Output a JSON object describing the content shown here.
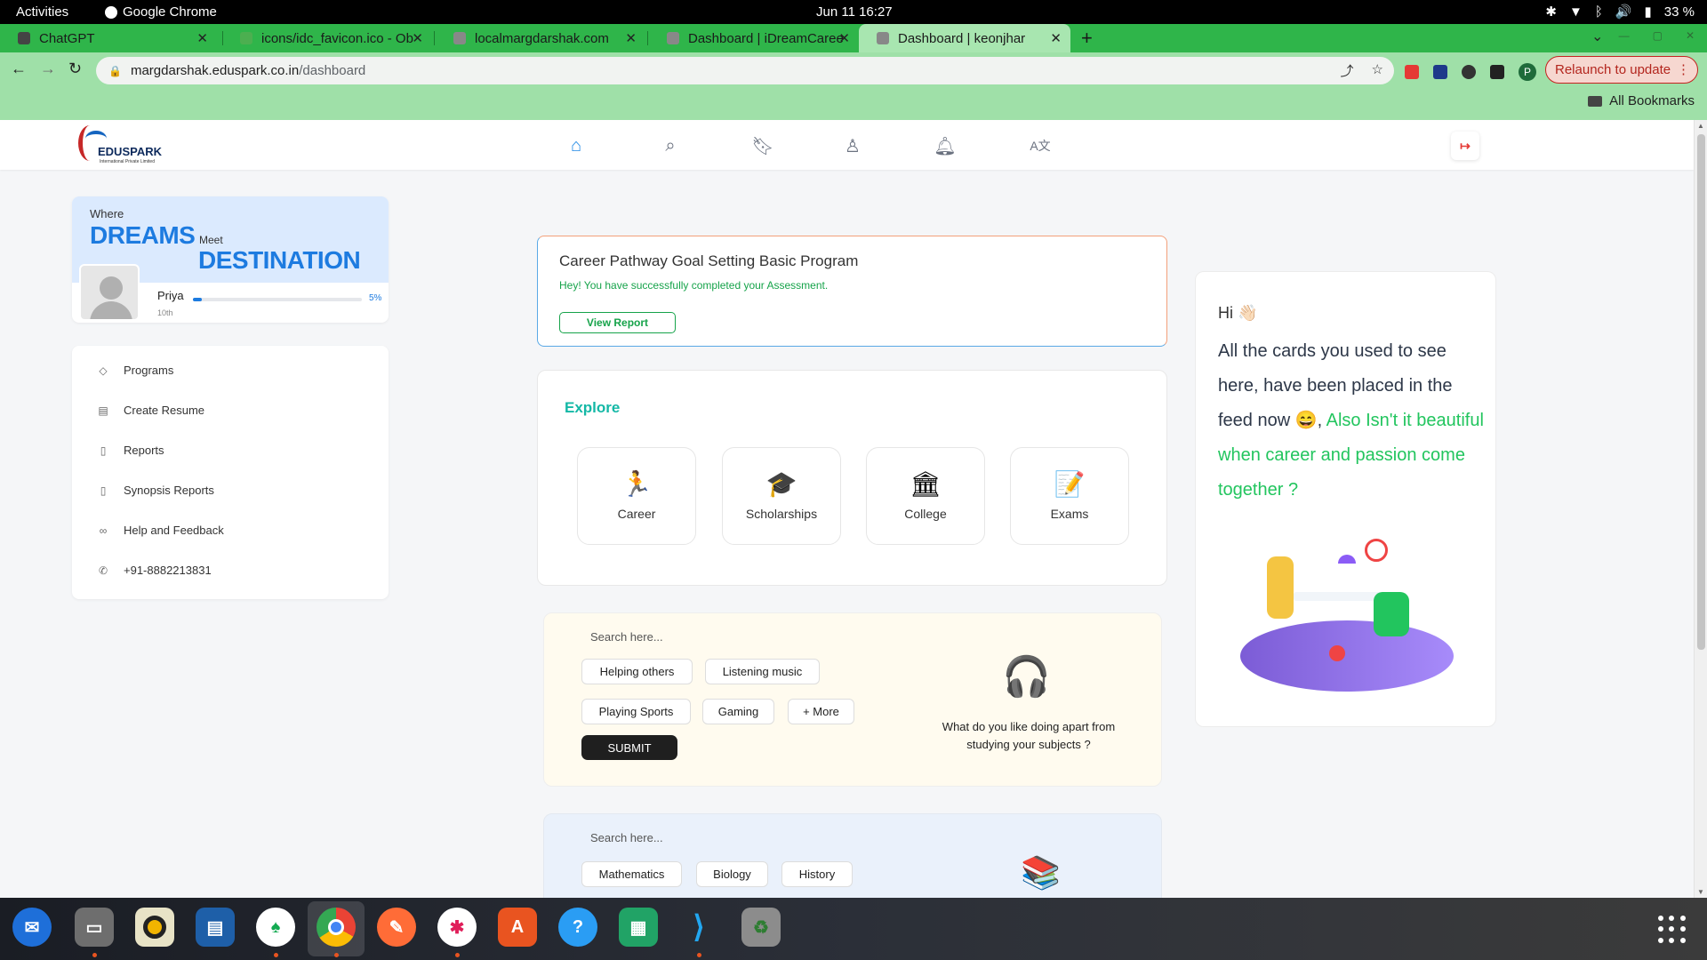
{
  "system": {
    "activities": "Activities",
    "app_name": "Google Chrome",
    "clock": "Jun 11  16:27",
    "battery": "33 %"
  },
  "tabs": [
    {
      "title": "ChatGPT",
      "favicon_color": "#444444"
    },
    {
      "title": "icons/idc_favicon.ico - Ob",
      "favicon_color": "#4caf50"
    },
    {
      "title": "localmargdarshak.com",
      "favicon_color": "#888888"
    },
    {
      "title": "Dashboard | iDreamCaree",
      "favicon_color": "#888888"
    },
    {
      "title": "Dashboard | keonjhar",
      "favicon_color": "#888888",
      "active": true
    }
  ],
  "toolbar": {
    "url_host": "margdarshak.eduspark.co.in",
    "url_path": "/dashboard",
    "profile_initial": "P",
    "relaunch_label": "Relaunch to update",
    "bookmarks_label": "All Bookmarks"
  },
  "logo": {
    "name": "EDUSPARK",
    "sub": "International Private Limited"
  },
  "nav_icons": [
    "home-icon",
    "search-icon",
    "bookmark-icon",
    "user-icon",
    "bell-icon",
    "translate-icon"
  ],
  "profile": {
    "banner_where": "Where",
    "banner_dreams": "DREAMS",
    "banner_meet": "Meet",
    "banner_destination": "DESTINATION",
    "name": "Priya",
    "grade": "10th",
    "progress_percent": 5,
    "progress_label": "5%"
  },
  "sidebar": {
    "items": [
      {
        "label": "Programs",
        "icon": "tag-icon"
      },
      {
        "label": "Create Resume",
        "icon": "clipboard-icon"
      },
      {
        "label": "Reports",
        "icon": "document-icon"
      },
      {
        "label": "Synopsis Reports",
        "icon": "document-icon"
      },
      {
        "label": "Help and Feedback",
        "icon": "handshake-icon"
      },
      {
        "label": "+91-8882213831",
        "icon": "phone-icon"
      }
    ]
  },
  "assessment": {
    "title": "Career Pathway Goal Setting Basic Program",
    "status": "Hey! You have successfully completed your Assessment.",
    "button": "View Report"
  },
  "explore": {
    "heading": "Explore",
    "cards": [
      {
        "label": "Career",
        "icon": "runner-icon"
      },
      {
        "label": "Scholarships",
        "icon": "graduation-cap-icon"
      },
      {
        "label": "College",
        "icon": "building-icon"
      },
      {
        "label": "Exams",
        "icon": "exam-paper-icon"
      }
    ]
  },
  "hobbies": {
    "search_placeholder": "Search here...",
    "chips": [
      "Helping others",
      "Listening music",
      "Playing Sports",
      "Gaming",
      "+ More"
    ],
    "submit": "SUBMIT",
    "question_line1": "What do you like doing apart from",
    "question_line2": "studying your subjects ?"
  },
  "subjects": {
    "search_placeholder": "Search here...",
    "chips": [
      "Mathematics",
      "Biology",
      "History"
    ]
  },
  "feed_card": {
    "hi": "Hi 👋🏻",
    "text": "All the cards you used to see here, have been placed in the feed now 😄,",
    "highlight": " Also Isn't it beautiful when career and passion come together ?"
  },
  "dock": {
    "apps": [
      "thunderbird-icon",
      "files-icon",
      "rhythmbox-icon",
      "libreoffice-writer-icon",
      "mongodb-compass-icon",
      "chrome-icon",
      "postman-icon",
      "slack-icon",
      "app-center-icon",
      "help-icon",
      "libreoffice-calc-icon",
      "vscode-icon",
      "trash-icon"
    ]
  }
}
